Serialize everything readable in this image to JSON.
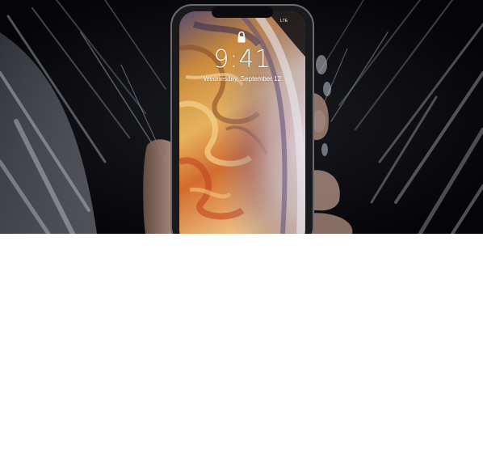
{
  "image": {
    "subject": "iPhone XS on lock screen held in hand with water splash",
    "accent_colors": {
      "background": "#07070a",
      "wallpaper_gold": "#e3a24b",
      "wallpaper_purple": "#6f5a9a",
      "wallpaper_orange": "#d4632a",
      "splash": "#c9ccd6"
    }
  },
  "lock_screen": {
    "carrier": "LTE",
    "time": "9:41",
    "date": "Wednesday, September 12",
    "lock_icon": "lock-icon"
  }
}
